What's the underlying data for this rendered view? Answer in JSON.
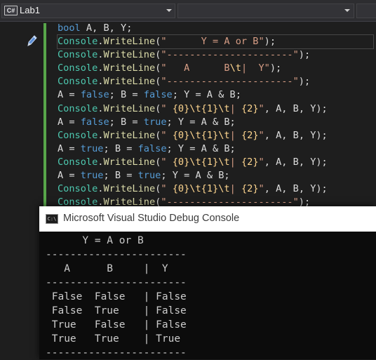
{
  "navbar": {
    "project_icon": "C#",
    "project_name": "Lab1",
    "member_value": ""
  },
  "editor": {
    "lines": [
      [
        {
          "t": "bool",
          "c": "kw"
        },
        {
          "t": " A, B, Y;",
          "c": "pl"
        }
      ],
      [
        {
          "t": "Console",
          "c": "ty"
        },
        {
          "t": ".",
          "c": "pl"
        },
        {
          "t": "WriteLine",
          "c": "fn"
        },
        {
          "t": "(",
          "c": "pl"
        },
        {
          "t": "\"      Y = A or B\"",
          "c": "str"
        },
        {
          "t": ");",
          "c": "pl"
        }
      ],
      [
        {
          "t": "Console",
          "c": "ty"
        },
        {
          "t": ".",
          "c": "pl"
        },
        {
          "t": "WriteLine",
          "c": "fn"
        },
        {
          "t": "(",
          "c": "pl"
        },
        {
          "t": "\"----------------------\"",
          "c": "str"
        },
        {
          "t": ");",
          "c": "pl"
        }
      ],
      [
        {
          "t": "Console",
          "c": "ty"
        },
        {
          "t": ".",
          "c": "pl"
        },
        {
          "t": "WriteLine",
          "c": "fn"
        },
        {
          "t": "(",
          "c": "pl"
        },
        {
          "t": "\"   A      B",
          "c": "str"
        },
        {
          "t": "\\t",
          "c": "esc"
        },
        {
          "t": "|  Y\"",
          "c": "str"
        },
        {
          "t": ");",
          "c": "pl"
        }
      ],
      [
        {
          "t": "Console",
          "c": "ty"
        },
        {
          "t": ".",
          "c": "pl"
        },
        {
          "t": "WriteLine",
          "c": "fn"
        },
        {
          "t": "(",
          "c": "pl"
        },
        {
          "t": "\"----------------------\"",
          "c": "str"
        },
        {
          "t": ");",
          "c": "pl"
        }
      ],
      [
        {
          "t": "A = ",
          "c": "pl"
        },
        {
          "t": "false",
          "c": "kw"
        },
        {
          "t": "; B = ",
          "c": "pl"
        },
        {
          "t": "false",
          "c": "kw"
        },
        {
          "t": "; Y = A & B;",
          "c": "pl"
        }
      ],
      [
        {
          "t": "Console",
          "c": "ty"
        },
        {
          "t": ".",
          "c": "pl"
        },
        {
          "t": "WriteLine",
          "c": "fn"
        },
        {
          "t": "(",
          "c": "pl"
        },
        {
          "t": "\" ",
          "c": "str"
        },
        {
          "t": "{0}",
          "c": "ph"
        },
        {
          "t": "\\t",
          "c": "esc"
        },
        {
          "t": "{1}",
          "c": "ph"
        },
        {
          "t": "\\t",
          "c": "esc"
        },
        {
          "t": "| ",
          "c": "str"
        },
        {
          "t": "{2}",
          "c": "ph"
        },
        {
          "t": "\"",
          "c": "str"
        },
        {
          "t": ", A, B, Y);",
          "c": "pl"
        }
      ],
      [
        {
          "t": "A = ",
          "c": "pl"
        },
        {
          "t": "false",
          "c": "kw"
        },
        {
          "t": "; B = ",
          "c": "pl"
        },
        {
          "t": "true",
          "c": "kw"
        },
        {
          "t": "; Y = A & B;",
          "c": "pl"
        }
      ],
      [
        {
          "t": "Console",
          "c": "ty"
        },
        {
          "t": ".",
          "c": "pl"
        },
        {
          "t": "WriteLine",
          "c": "fn"
        },
        {
          "t": "(",
          "c": "pl"
        },
        {
          "t": "\" ",
          "c": "str"
        },
        {
          "t": "{0}",
          "c": "ph"
        },
        {
          "t": "\\t",
          "c": "esc"
        },
        {
          "t": "{1}",
          "c": "ph"
        },
        {
          "t": "\\t",
          "c": "esc"
        },
        {
          "t": "| ",
          "c": "str"
        },
        {
          "t": "{2}",
          "c": "ph"
        },
        {
          "t": "\"",
          "c": "str"
        },
        {
          "t": ", A, B, Y);",
          "c": "pl"
        }
      ],
      [
        {
          "t": "A = ",
          "c": "pl"
        },
        {
          "t": "true",
          "c": "kw"
        },
        {
          "t": "; B = ",
          "c": "pl"
        },
        {
          "t": "false",
          "c": "kw"
        },
        {
          "t": "; Y = A & B;",
          "c": "pl"
        }
      ],
      [
        {
          "t": "Console",
          "c": "ty"
        },
        {
          "t": ".",
          "c": "pl"
        },
        {
          "t": "WriteLine",
          "c": "fn"
        },
        {
          "t": "(",
          "c": "pl"
        },
        {
          "t": "\" ",
          "c": "str"
        },
        {
          "t": "{0}",
          "c": "ph"
        },
        {
          "t": "\\t",
          "c": "esc"
        },
        {
          "t": "{1}",
          "c": "ph"
        },
        {
          "t": "\\t",
          "c": "esc"
        },
        {
          "t": "| ",
          "c": "str"
        },
        {
          "t": "{2}",
          "c": "ph"
        },
        {
          "t": "\"",
          "c": "str"
        },
        {
          "t": ", A, B, Y);",
          "c": "pl"
        }
      ],
      [
        {
          "t": "A = ",
          "c": "pl"
        },
        {
          "t": "true",
          "c": "kw"
        },
        {
          "t": "; B = ",
          "c": "pl"
        },
        {
          "t": "true",
          "c": "kw"
        },
        {
          "t": "; Y = A & B;",
          "c": "pl"
        }
      ],
      [
        {
          "t": "Console",
          "c": "ty"
        },
        {
          "t": ".",
          "c": "pl"
        },
        {
          "t": "WriteLine",
          "c": "fn"
        },
        {
          "t": "(",
          "c": "pl"
        },
        {
          "t": "\" ",
          "c": "str"
        },
        {
          "t": "{0}",
          "c": "ph"
        },
        {
          "t": "\\t",
          "c": "esc"
        },
        {
          "t": "{1}",
          "c": "ph"
        },
        {
          "t": "\\t",
          "c": "esc"
        },
        {
          "t": "| ",
          "c": "str"
        },
        {
          "t": "{2}",
          "c": "ph"
        },
        {
          "t": "\"",
          "c": "str"
        },
        {
          "t": ", A, B, Y);",
          "c": "pl"
        }
      ],
      [
        {
          "t": "Console",
          "c": "ty"
        },
        {
          "t": ".",
          "c": "pl"
        },
        {
          "t": "WriteLine",
          "c": "fn"
        },
        {
          "t": "(",
          "c": "pl"
        },
        {
          "t": "\"----------------------\"",
          "c": "str"
        },
        {
          "t": ");",
          "c": "pl"
        }
      ]
    ]
  },
  "console": {
    "icon_text": "C:\\",
    "title": "Microsoft Visual Studio Debug Console",
    "output": [
      "      Y = A or B",
      "-----------------------",
      "   A      B     |  Y",
      "-----------------------",
      " False  False   | False",
      " False  True    | False",
      " True   False   | False",
      " True   True    | True",
      "-----------------------"
    ]
  },
  "colors": {
    "editor_bg": "#1e1e1e",
    "keyword": "#569cd6",
    "type": "#4ec9b0",
    "method": "#dcdcaa",
    "string": "#d69d85",
    "change_bar": "#57a64a",
    "console_bg": "#0c0c0c"
  }
}
